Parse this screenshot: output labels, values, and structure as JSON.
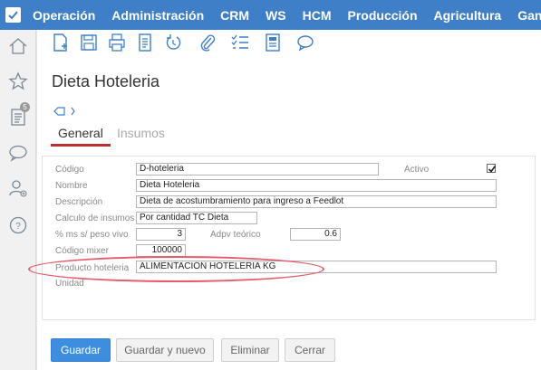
{
  "topbar": {
    "menu": [
      "Operación",
      "Administración",
      "CRM",
      "WS",
      "HCM",
      "Producción",
      "Agricultura",
      "Ganad"
    ]
  },
  "sidebar": {
    "items": [
      "home-icon",
      "star-icon",
      "clipboard-icon",
      "chat-icon",
      "user-add-icon",
      "help-icon"
    ],
    "badge": "5"
  },
  "toolbar": {
    "icons": [
      "new-document-icon",
      "save-icon",
      "print-icon",
      "list-document-icon",
      "refresh-icon",
      "attach-icon",
      "checklist-icon",
      "report-icon",
      "comment-icon"
    ]
  },
  "page": {
    "title": "Dieta Hoteleria",
    "tabs": [
      "General",
      "Insumos"
    ]
  },
  "form": {
    "codigo_label": "Código",
    "codigo_value": "D-hoteleria",
    "activo_label": "Activo",
    "activo_checked": true,
    "nombre_label": "Nombre",
    "nombre_value": "Dieta Hoteleria",
    "descripcion_label": "Descripción",
    "descripcion_value": "Dieta de acostumbramiento para ingreso a Feedlot",
    "calculo_label": "Calculo de insumos",
    "calculo_value": "Por cantidad TC Dieta",
    "ms_label": "% ms s/ peso vivo",
    "ms_value": "3",
    "adpv_label": "Adpv teórico",
    "adpv_value": "0.6",
    "mixer_label": "Código mixer",
    "mixer_value": "100000",
    "producto_label": "Producto hoteleria",
    "producto_value": "ALIMENTACIÓN HOTELERIA KG",
    "unidad_label": "Unidad"
  },
  "buttons": {
    "guardar": "Guardar",
    "guardar_nuevo": "Guardar y nuevo",
    "eliminar": "Eliminar",
    "cerrar": "Cerrar"
  },
  "colors": {
    "topbar": "#3f7fc8",
    "primary_button": "#3e8ee0",
    "active_tab": "#b8322f",
    "highlight_ellipse": "#e55b6b"
  }
}
